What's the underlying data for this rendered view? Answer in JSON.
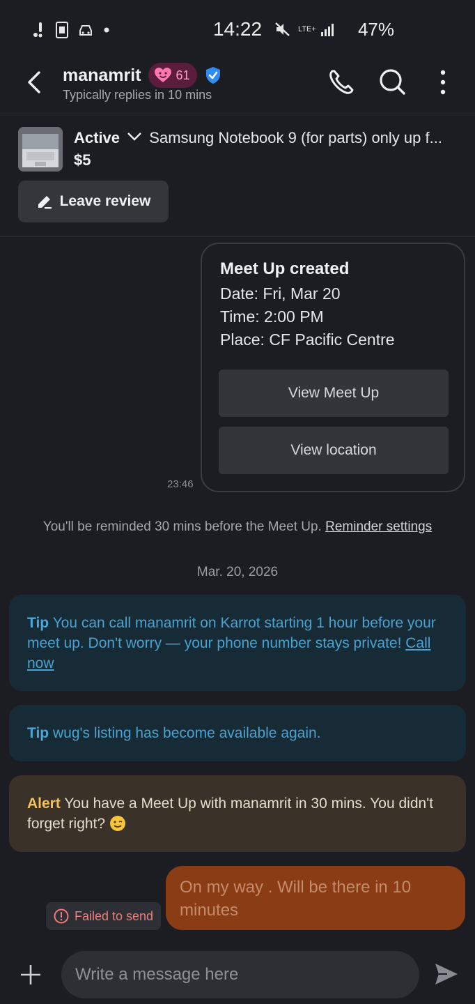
{
  "status_bar": {
    "time": "14:22",
    "battery": "47%",
    "left_icons": [
      "notification-icon",
      "sim-icon",
      "car-icon",
      "dot-icon"
    ],
    "right_icons": [
      "mute-icon",
      "lte-icon",
      "signal-icon"
    ],
    "network": "LTE+"
  },
  "header": {
    "user_name": "manamrit",
    "temperature": "61",
    "subtitle": "Typically replies in 10 mins",
    "icons": [
      "back-icon",
      "heart-badge-icon",
      "verified-icon",
      "phone-icon",
      "search-icon",
      "more-icon"
    ]
  },
  "product": {
    "status": "Active",
    "title": "Samsung Notebook 9 (for parts) only up f...",
    "price": "$5",
    "review_label": "Leave review"
  },
  "meet_up": {
    "title": "Meet Up created",
    "date": "Date: Fri, Mar 20",
    "time": "Time: 2:00 PM",
    "place": "Place: CF Pacific Centre",
    "view_meet_label": "View Meet Up",
    "view_location_label": "View location",
    "timestamp": "23:46"
  },
  "reminder": {
    "text": "You'll be reminded 30 mins before the Meet Up.",
    "link": "Reminder settings"
  },
  "date_separator": "Mar. 20, 2026",
  "notices": {
    "tip1_label": "Tip",
    "tip1_text": "You can call manamrit on Karrot starting 1 hour before your meet up. Don't worry — your phone number stays private!",
    "tip1_link": "Call now",
    "tip2_label": "Tip",
    "tip2_text": "wug's listing has become available again.",
    "alert_label": "Alert",
    "alert_text": "You have a Meet Up with manamrit in 30 mins. You didn't forget right?"
  },
  "my_message": {
    "text": "On my way . Will be there in 10 minutes",
    "failed_label": "Failed to send"
  },
  "composer": {
    "placeholder": "Write a message here"
  },
  "colors": {
    "background": "#1c1d22",
    "tip_bg": "#172b37",
    "tip_text": "#4aa2cf",
    "alert_bg": "#3a3128",
    "alert_label": "#f4c15a",
    "my_bubble": "#8a3d15",
    "error": "#f07b7b",
    "verified": "#2f8cf0",
    "temperature_badge": "#5a1d3b"
  }
}
